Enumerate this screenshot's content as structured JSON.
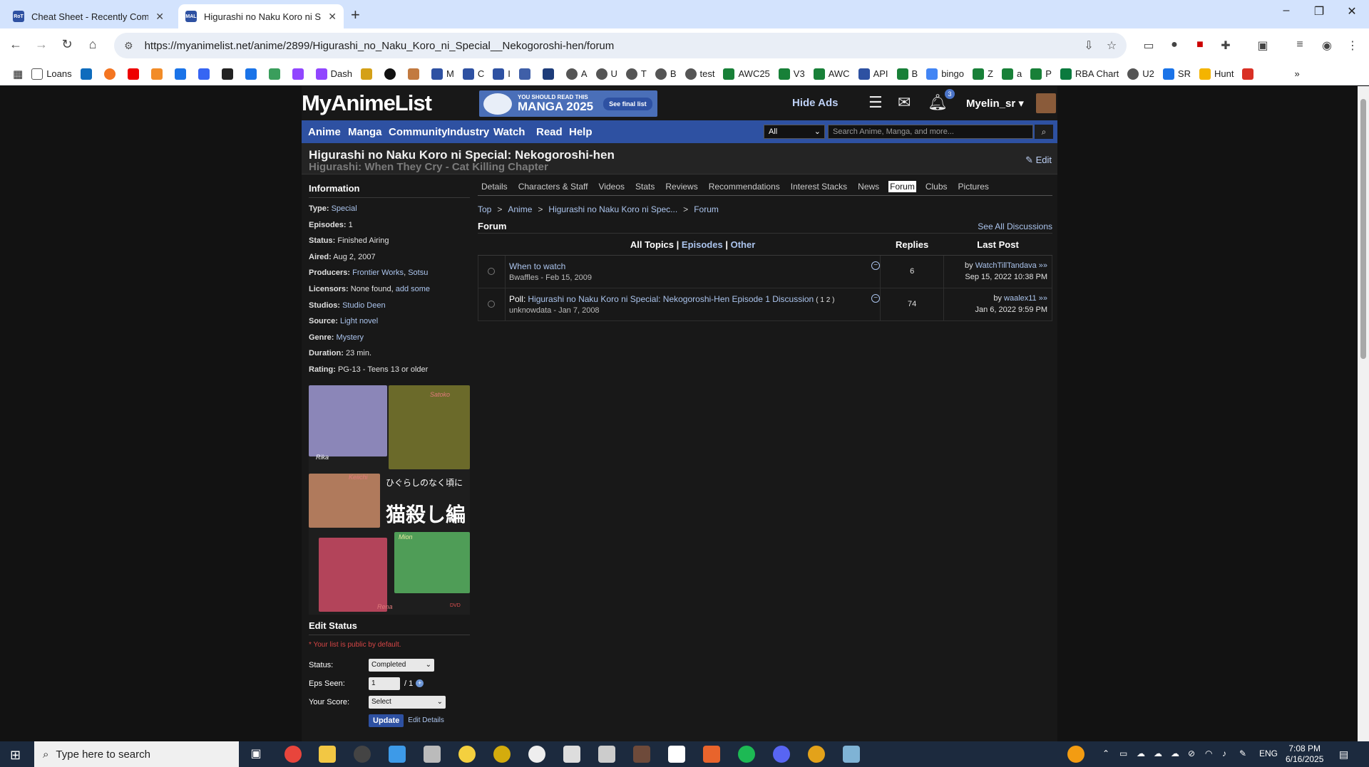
{
  "browser": {
    "tabs": [
      {
        "title": "Cheat Sheet - Recently Complet",
        "active": false
      },
      {
        "title": "Higurashi no Naku Koro ni Spec",
        "active": true
      }
    ],
    "url": "https://myanimelist.net/anime/2899/Higurashi_no_Naku_Koro_ni_Special__Nekogoroshi-hen/forum",
    "bookmarks": [
      "Loans",
      "Dash",
      "A",
      "U",
      "T",
      "B",
      "test",
      "AWC25",
      "V3",
      "AWC",
      "API",
      "B",
      "bingo",
      "Z",
      "a",
      "P",
      "RBA Chart",
      "U2",
      "SR",
      "Hunt"
    ],
    "bookmark_labels_short": [
      "M",
      "C",
      "I"
    ]
  },
  "site": {
    "logo": "MyAnimeList",
    "banner": {
      "line1": "YOU SHOULD READ THIS",
      "line2": "MANGA 2025",
      "button": "See final list"
    },
    "hide_ads": "Hide Ads",
    "notification_count": "3",
    "username": "Myelin_sr",
    "nav": [
      "Anime",
      "Manga",
      "Community",
      "Industry",
      "Watch",
      "Read",
      "Help"
    ],
    "search": {
      "type": "All",
      "placeholder": "Search Anime, Manga, and more..."
    }
  },
  "title": {
    "main": "Higurashi no Naku Koro ni Special: Nekogoroshi-hen",
    "english": "Higurashi: When They Cry - Cat Killing Chapter",
    "edit": "Edit"
  },
  "info": {
    "heading": "Information",
    "type": {
      "label": "Type:",
      "value": "Special"
    },
    "episodes": {
      "label": "Episodes:",
      "value": "1"
    },
    "status": {
      "label": "Status:",
      "value": "Finished Airing"
    },
    "aired": {
      "label": "Aired:",
      "value": "Aug 2, 2007"
    },
    "producers": {
      "label": "Producers:",
      "value1": "Frontier Works",
      "sep": ",",
      "value2": "Sotsu"
    },
    "licensors": {
      "label": "Licensors:",
      "value": "None found,",
      "link": "add some"
    },
    "studios": {
      "label": "Studios:",
      "value": "Studio Deen"
    },
    "source": {
      "label": "Source:",
      "value": "Light novel"
    },
    "genre": {
      "label": "Genre:",
      "value": "Mystery"
    },
    "duration": {
      "label": "Duration:",
      "value": "23 min."
    },
    "rating": {
      "label": "Rating:",
      "value": "PG-13 - Teens 13 or older"
    }
  },
  "cover": {
    "names": [
      "Rika",
      "Satoko",
      "Keiichi",
      "Mion",
      "Rena"
    ],
    "jp_title": "ひぐらしのなく頃に",
    "jp_subtitle": "猫殺し編",
    "dvd": "DVD"
  },
  "edit_status": {
    "heading": "Edit Status",
    "note": "* Your list is public by default.",
    "status_label": "Status:",
    "status_value": "Completed",
    "eps_label": "Eps Seen:",
    "eps_value": "1",
    "eps_total": "/ 1",
    "score_label": "Your Score:",
    "score_value": "Select",
    "update": "Update",
    "edit_details": "Edit Details"
  },
  "subtabs": [
    "Details",
    "Characters & Staff",
    "Videos",
    "Stats",
    "Reviews",
    "Recommendations",
    "Interest Stacks",
    "News",
    "Forum",
    "Clubs",
    "Pictures"
  ],
  "active_subtab": "Forum",
  "breadcrumbs": [
    "Top",
    "Anime",
    "Higurashi no Naku Koro ni Spec...",
    "Forum"
  ],
  "forum": {
    "heading": "Forum",
    "see_all": "See All Discussions",
    "filters": {
      "all": "All Topics",
      "sep": "|",
      "episodes": "Episodes",
      "other": "Other"
    },
    "col_replies": "Replies",
    "col_last_post": "Last Post",
    "topics": [
      {
        "prefix": "",
        "title": "When to watch",
        "pages": "",
        "author": "Bwaffles",
        "date": "Feb 15, 2009",
        "replies": "6",
        "last_by": "WatchTillTandava",
        "last_date": "Sep 15, 2022 10:38 PM"
      },
      {
        "prefix": "Poll:",
        "title": "Higurashi no Naku Koro ni Special: Nekogoroshi-Hen Episode 1 Discussion",
        "pages": "( 1 2 )",
        "author": "unknowdata",
        "date": "Jan 7, 2008",
        "replies": "74",
        "last_by": "waalex11",
        "last_date": "Jan 6, 2022 9:59 PM"
      }
    ],
    "by": "by",
    "arrow": "»»"
  },
  "taskbar": {
    "search_placeholder": "Type here to search",
    "lang": "ENG",
    "time": "7:08 PM",
    "date": "6/16/2025"
  }
}
